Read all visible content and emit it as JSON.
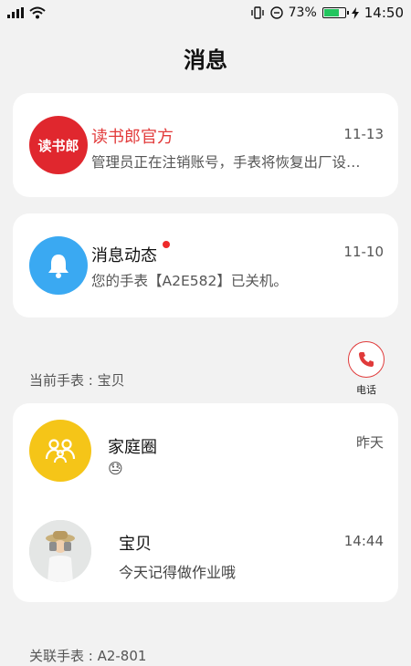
{
  "status_bar": {
    "battery_percent": "73%",
    "time": "14:50",
    "battery_level": 0.73,
    "icons": [
      "signal-icon",
      "wifi-icon",
      "vibrate-icon",
      "dnd-icon",
      "battery-icon",
      "charging-icon"
    ]
  },
  "page": {
    "title": "消息"
  },
  "conversations": [
    {
      "logo_text": "读书郎",
      "name": "读书郎官方",
      "preview": "管理员正在注销账号，手表将恢复出厂设…",
      "time": "11-13",
      "name_color": "#e23b3b",
      "avatar_color": "#e0272e"
    },
    {
      "name": "消息动态",
      "preview": "您的手表【A2E582】已关机。",
      "time": "11-10",
      "unread": true,
      "avatar_color": "#3aa9f2",
      "icon": "bell-icon"
    }
  ],
  "current_watch": {
    "label": "当前手表 : 宝贝",
    "call_button": {
      "label": "电话",
      "icon": "phone-icon"
    },
    "chats": [
      {
        "name": "家庭圈",
        "preview_emoji": "😓",
        "time": "昨天",
        "avatar_color": "#f5c518",
        "icon": "family-icon"
      },
      {
        "name": "宝贝",
        "preview": "今天记得做作业哦",
        "time": "14:44",
        "avatar": "child-photo"
      }
    ]
  },
  "linked_watch": {
    "label": "关联手表 : A2-801"
  },
  "colors": {
    "background": "#f2f2f2",
    "accent_red": "#e03a3a"
  }
}
